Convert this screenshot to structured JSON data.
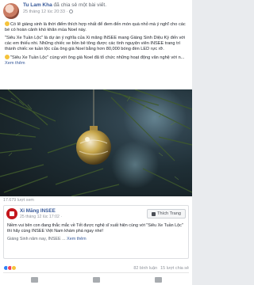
{
  "header": {
    "author": "Tu Lam Kha",
    "shared_text": "đã chia sẻ một bài viết.",
    "timestamp": "25 tháng 12 lúc 20:33 ·"
  },
  "body": {
    "paragraph1": "Có lẽ giáng sinh là thời điểm thích hợp nhất để đem đến món quà nhỏ mà ý nghĩ cho các bé có hoàn cảnh khó khăn mùa Noel này.",
    "paragraph2": "\"Siêu Xe Tuần Lộc\" là dự án ý nghĩa của Xi măng INSEE mang Giáng Sinh Diệu Kỳ đến với các em thiếu nhi. Những chiếc xe bồn bê tông được các tình nguyện viên INSEE trang trí thành chiếc xe tuần lộc của ông già Noel bằng hơn 80,000 bóng đèn LED rực rỡ.",
    "paragraph3": "\"Siêu Xe Tuần Lộc\" cùng với ông già Noel đã tổ chức những hoạt động văn nghệ với n...",
    "see_more": "Xem thêm"
  },
  "photo": {
    "colors": {
      "bg": "#1f2f36",
      "ornament": "#c9a94e",
      "branch": "#3f5a2c"
    }
  },
  "counts": {
    "views": "17.679 lượt xem"
  },
  "shared_card": {
    "page_name": "Xi Măng INSEE",
    "date": "25 tháng 12 lúc 17:02 ·",
    "like_page_label": "Thích Trang",
    "text": "Niềm vui bên con đang thắc mắc về Tết được nghệ sĩ xuất hiện cùng với \"Siêu Xe Tuần Lộc\" thì hãy cùng INSEE Việt Nam khám phá ngay nhé!",
    "extra": "Giáng Sinh năm nay, INSEE ...",
    "see_more": "Xem thêm"
  },
  "reactions": {
    "likes": "82 bình luận",
    "shares": "15 lượt chia sẻ"
  },
  "colors": {
    "link": "#365899",
    "muted": "#90949c"
  }
}
